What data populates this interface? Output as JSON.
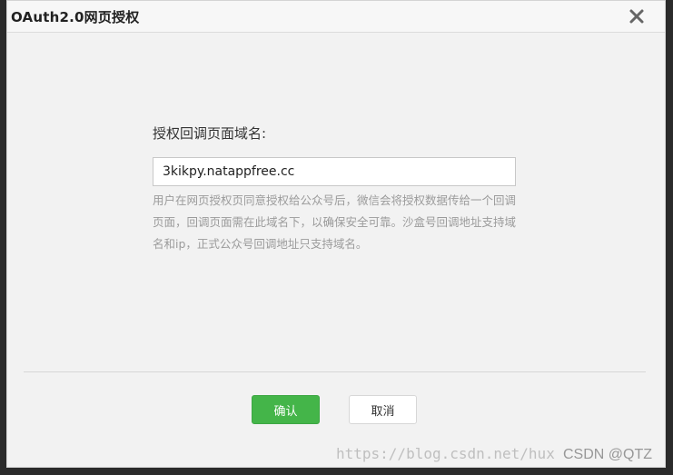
{
  "dialog": {
    "title": "OAuth2.0网页授权",
    "close_icon": "close-icon"
  },
  "form": {
    "label": "授权回调页面域名:",
    "domain_value": "3kikpy.natappfree.cc",
    "hint": "用户在网页授权页同意授权给公众号后，微信会将授权数据传给一个回调页面，回调页面需在此域名下，以确保安全可靠。沙盒号回调地址支持域名和ip，正式公众号回调地址只支持域名。"
  },
  "buttons": {
    "confirm_label": "确认",
    "cancel_label": "取消"
  },
  "watermark": {
    "url_text": "https://blog.csdn.net/hux",
    "tag_text": "CSDN @QTZ"
  },
  "colors": {
    "confirm_bg": "#44b549",
    "dialog_bg": "#f2f2f2",
    "hint_text": "#9b9b9b"
  }
}
